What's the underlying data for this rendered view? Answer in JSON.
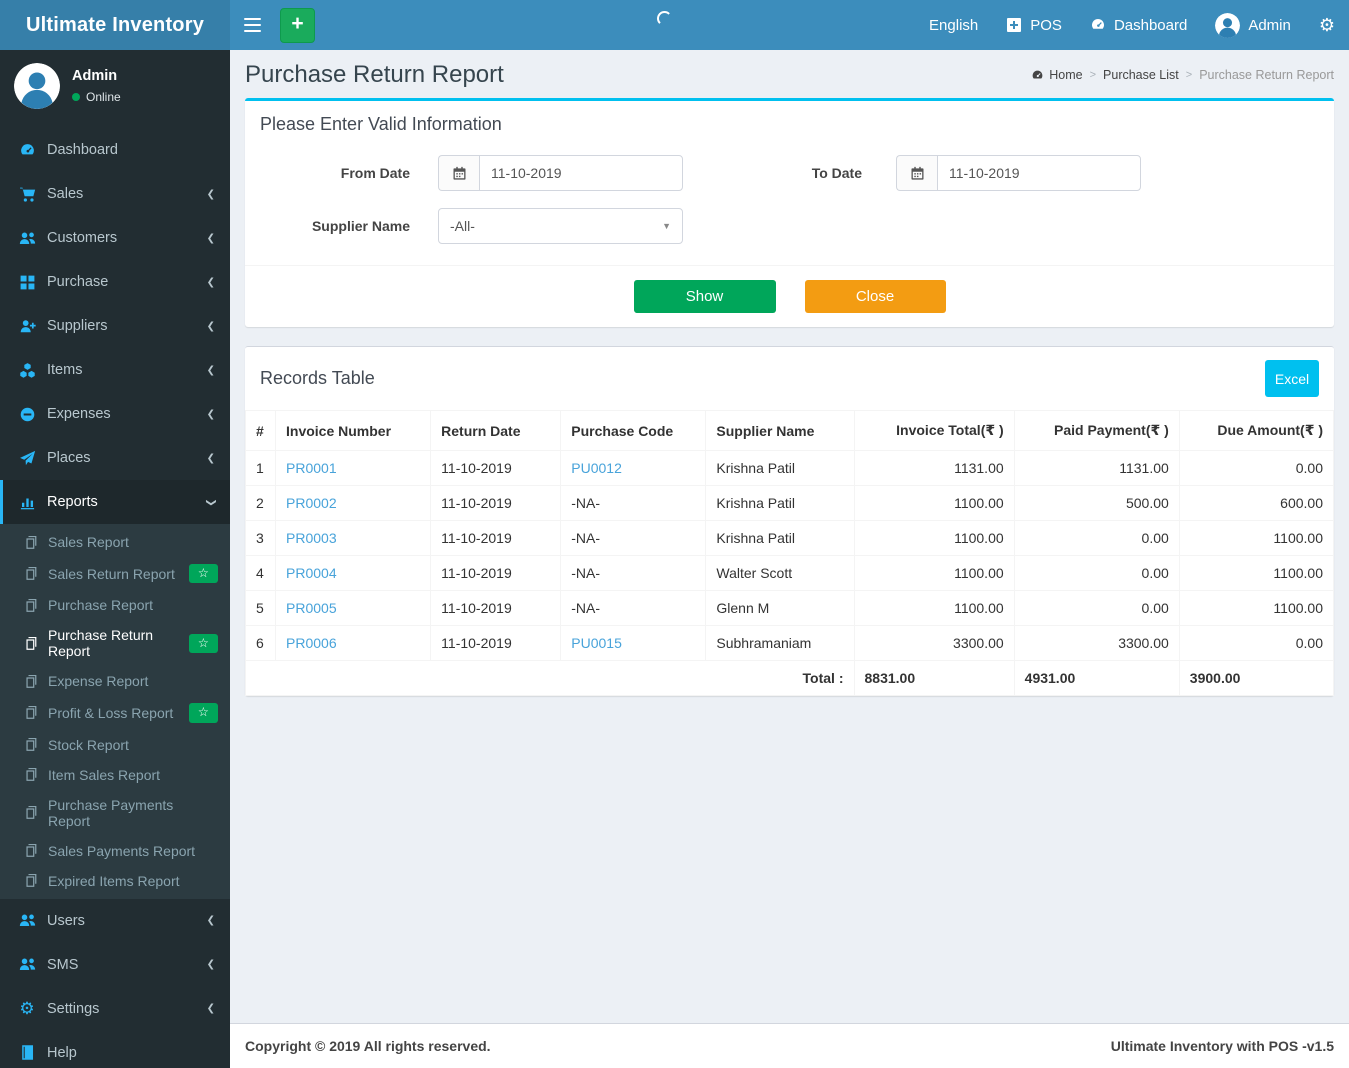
{
  "app": {
    "title": "Ultimate Inventory",
    "copyright": "Copyright © 2019 All rights reserved.",
    "version_text": "Ultimate Inventory with POS -v1.5"
  },
  "navbar": {
    "items": [
      {
        "id": "language",
        "label": "English"
      },
      {
        "id": "pos",
        "label": "POS",
        "icon": "plus-square"
      },
      {
        "id": "dashboard",
        "label": "Dashboard",
        "icon": "gauge"
      },
      {
        "id": "user",
        "label": "Admin",
        "avatar": true
      },
      {
        "id": "settings",
        "label": "",
        "icon": "cogs"
      }
    ]
  },
  "user_panel": {
    "name": "Admin",
    "status": "Online"
  },
  "sidebar": {
    "items": [
      {
        "id": "dashboard",
        "label": "Dashboard",
        "icon": "gauge",
        "chevron": false
      },
      {
        "id": "sales",
        "label": "Sales",
        "icon": "cart",
        "chevron": true
      },
      {
        "id": "customers",
        "label": "Customers",
        "icon": "users",
        "chevron": true
      },
      {
        "id": "purchase",
        "label": "Purchase",
        "icon": "grid",
        "chevron": true
      },
      {
        "id": "suppliers",
        "label": "Suppliers",
        "icon": "user-plus",
        "chevron": true
      },
      {
        "id": "items",
        "label": "Items",
        "icon": "cubes",
        "chevron": true
      },
      {
        "id": "expenses",
        "label": "Expenses",
        "icon": "minus-circle",
        "chevron": true
      },
      {
        "id": "places",
        "label": "Places",
        "icon": "send",
        "chevron": true
      },
      {
        "id": "reports",
        "label": "Reports",
        "icon": "bar-chart",
        "chevron": "down",
        "active": true,
        "children": [
          {
            "id": "sales-report",
            "label": "Sales Report"
          },
          {
            "id": "sales-return-report",
            "label": "Sales Return Report",
            "badge": true
          },
          {
            "id": "purchase-report",
            "label": "Purchase Report"
          },
          {
            "id": "purchase-return-report",
            "label": "Purchase Return Report",
            "badge": true,
            "active": true
          },
          {
            "id": "expense-report",
            "label": "Expense Report"
          },
          {
            "id": "profit-loss-report",
            "label": "Profit & Loss Report",
            "badge": true
          },
          {
            "id": "stock-report",
            "label": "Stock Report"
          },
          {
            "id": "item-sales-report",
            "label": "Item Sales Report"
          },
          {
            "id": "purchase-payments-report",
            "label": "Purchase Payments Report"
          },
          {
            "id": "sales-payments-report",
            "label": "Sales Payments Report"
          },
          {
            "id": "expired-items-report",
            "label": "Expired Items Report"
          }
        ]
      },
      {
        "id": "users",
        "label": "Users",
        "icon": "users",
        "chevron": true
      },
      {
        "id": "sms",
        "label": "SMS",
        "icon": "users",
        "chevron": true
      },
      {
        "id": "settings",
        "label": "Settings",
        "icon": "cogs",
        "chevron": true
      },
      {
        "id": "help",
        "label": "Help",
        "icon": "book",
        "chevron": false
      }
    ]
  },
  "page": {
    "title": "Purchase Return Report",
    "breadcrumb": [
      {
        "label": "Home",
        "icon": "gauge"
      },
      {
        "label": "Purchase List"
      },
      {
        "label": "Purchase Return Report",
        "current": true
      }
    ]
  },
  "filter": {
    "panel_title": "Please Enter Valid Information",
    "from_date_label": "From Date",
    "from_date_value": "11-10-2019",
    "to_date_label": "To Date",
    "to_date_value": "11-10-2019",
    "supplier_label": "Supplier Name",
    "supplier_value": "-All-",
    "show_label": "Show",
    "close_label": "Close"
  },
  "records": {
    "panel_title": "Records Table",
    "excel_label": "Excel",
    "columns": [
      "#",
      "Invoice Number",
      "Return Date",
      "Purchase Code",
      "Supplier Name",
      "Invoice Total(₹ )",
      "Paid Payment(₹ )",
      "Due Amount(₹ )"
    ],
    "rows": [
      [
        "1",
        "PR0001",
        "11-10-2019",
        "PU0012",
        "Krishna Patil",
        "1131.00",
        "1131.00",
        "0.00"
      ],
      [
        "2",
        "PR0002",
        "11-10-2019",
        "-NA-",
        "Krishna Patil",
        "1100.00",
        "500.00",
        "600.00"
      ],
      [
        "3",
        "PR0003",
        "11-10-2019",
        "-NA-",
        "Krishna Patil",
        "1100.00",
        "0.00",
        "1100.00"
      ],
      [
        "4",
        "PR0004",
        "11-10-2019",
        "-NA-",
        "Walter Scott",
        "1100.00",
        "0.00",
        "1100.00"
      ],
      [
        "5",
        "PR0005",
        "11-10-2019",
        "-NA-",
        "Glenn M",
        "1100.00",
        "0.00",
        "1100.00"
      ],
      [
        "6",
        "PR0006",
        "11-10-2019",
        "PU0015",
        "Subhramaniam",
        "3300.00",
        "3300.00",
        "0.00"
      ]
    ],
    "na_text": "-NA-",
    "total_label": "Total :",
    "totals": [
      "8831.00",
      "4931.00",
      "3900.00"
    ]
  },
  "colors": {
    "navbar": "#3c8dbc",
    "logo": "#367fa9",
    "sidebar": "#222d32",
    "submenu": "#2c3b41",
    "accent_cyan": "#00c0ef",
    "icon_cyan": "#29b6f6",
    "green": "#00a65a",
    "orange": "#f39c12",
    "page_bg": "#ecf0f5",
    "link": "#48a3da"
  }
}
